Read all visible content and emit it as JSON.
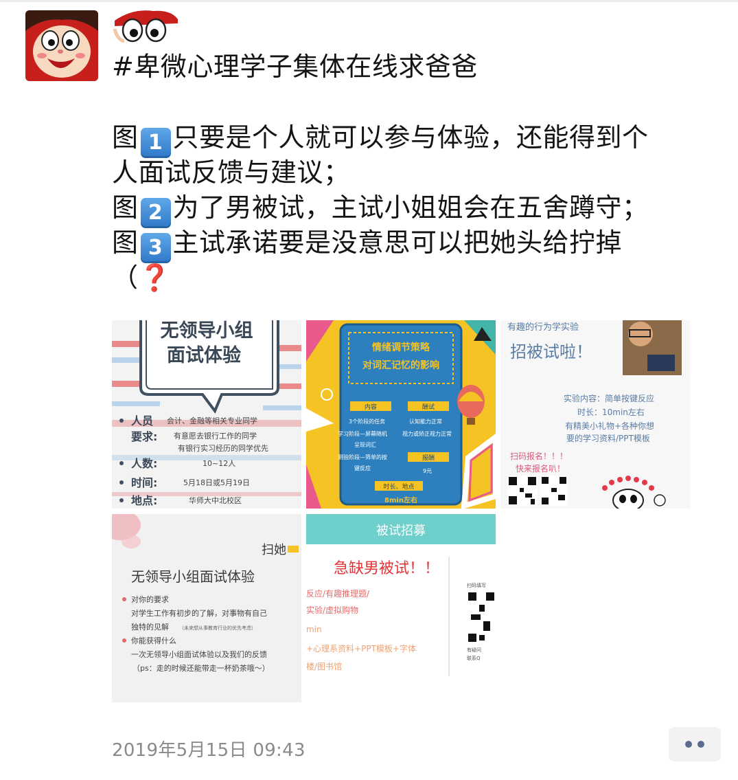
{
  "post": {
    "lines": [
      {
        "id": "title",
        "segments": [
          {
            "text": "#卑微心理学子集体在线求爸爸"
          }
        ]
      },
      {
        "id": "blank"
      },
      {
        "id": "l1",
        "segments": [
          {
            "text": "图"
          },
          {
            "keycap": "1"
          },
          {
            "text": "只要是个人就可以参与体验，还能得到个"
          }
        ]
      },
      {
        "id": "l2",
        "segments": [
          {
            "text": "人面试反馈与建议；"
          }
        ]
      },
      {
        "id": "l3",
        "segments": [
          {
            "text": "图"
          },
          {
            "keycap": "2"
          },
          {
            "text": "为了男被试，主试小姐姐会在五舍蹲守；"
          }
        ]
      },
      {
        "id": "l4",
        "segments": [
          {
            "text": "图"
          },
          {
            "keycap": "3"
          },
          {
            "text": "主试承诺要是没意思可以把她头给拧掉"
          }
        ]
      },
      {
        "id": "l5",
        "segments": [
          {
            "text": "（"
          },
          {
            "emoji": "❓"
          }
        ]
      }
    ],
    "timestamp": "2019年5月15日 09:43"
  },
  "images": {
    "img1": {
      "heading1": "无领导小组",
      "heading2": "面试体验",
      "req_label": "人员",
      "req_label2": "要求:",
      "req_text1": "会计、金融等相关专业同学",
      "req_text2": "有意愿去银行工作的同学",
      "req_text3": "有银行实习经历的同学优先",
      "count_label": "人数:",
      "count_value": "10~12人",
      "time_label": "时间:",
      "time_value": "5月18日或5月19日",
      "place_label": "地点:",
      "place_value": "华师大中北校区"
    },
    "img2": {
      "title1": "情绪调节策略",
      "title2": "对词汇记忆的影响",
      "content_label": "内容",
      "reward_label": "酬试",
      "c1": "3个阶段的任务",
      "c2": "学习阶段—屏幕随机",
      "c3": "呈现词汇",
      "c4": "测验阶段—筛单的按",
      "c5": "键反应",
      "r1": "认知能力正常",
      "r2": "视力或矫正视力正常",
      "fee_label": "报酬",
      "fee_value": "9元",
      "timeplace_label": "时长、地点",
      "duration": "8min左右"
    },
    "img3": {
      "top_text": "有趣的行为学实验",
      "heading": "招被试啦！",
      "l1": "实验内容：简单按键反应",
      "l2": "时长：10min左右",
      "l3": "有精美小礼物+各种你想",
      "l4": "要的学习资料/PPT模板",
      "scan1": "扫码报名！！！",
      "scan2": "快来报名叭！"
    },
    "img4": {
      "corner": "扫她",
      "title": "无领导小组面试体验",
      "b1": "对你的要求",
      "b1a": "对学生工作有初步的了解，对事物有自己",
      "b1b": "独特的见解",
      "b1c": "（未来想从事教育行业的优先考虑）",
      "b2": "你能获得什么",
      "b2a": "一次无领导小组面试体验以及我们的反馈",
      "b2b": "（ps：走的时候还能带走一杯奶茶哦～）"
    },
    "img5": {
      "banner": "被试招募",
      "heading": "急缺男被试！！",
      "l1": "反应/有趣推理题/",
      "l2": "实验/虚拟购物",
      "l3": "min",
      "l4": "+心理系资料+PPT模板+字体",
      "l5": "楼/图书馆",
      "qr_caption1": "扫码填写",
      "qr_caption2": "有疑问",
      "qr_caption3": "联系Q"
    }
  },
  "colors": {
    "keycap": "#3c8ad8",
    "qmark": "#d8232a",
    "timestamp": "#8a8a8a",
    "more_dots": "#5a6d8e",
    "img2_bg": "#2e7fbd",
    "img2_yellow": "#f6c324",
    "img5_banner": "#6ecfcb"
  }
}
